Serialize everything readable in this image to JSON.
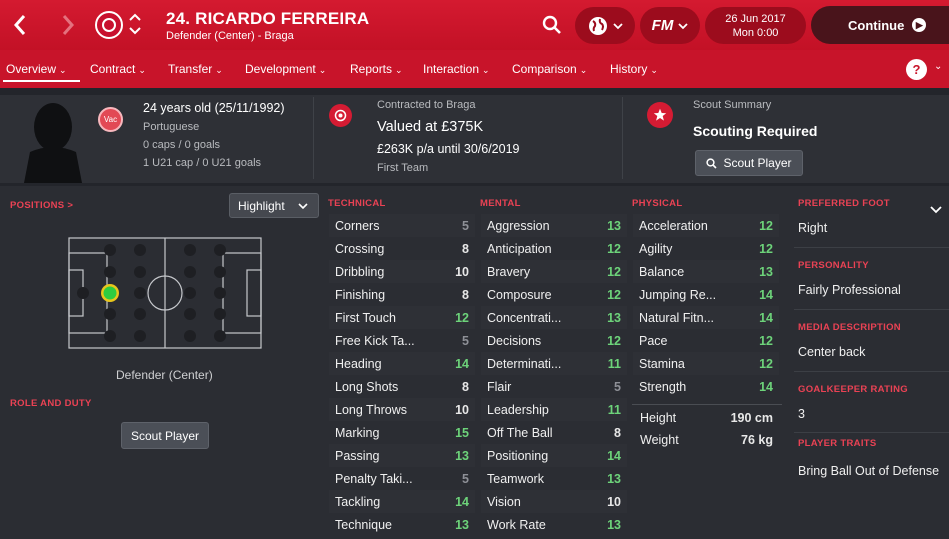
{
  "header": {
    "player_name": "24. RICARDO FERREIRA",
    "player_subtitle": "Defender (Center) - Braga",
    "date": "26 Jun 2017",
    "time": "Mon 0:00",
    "fm_label": "FM",
    "continue_label": "Continue"
  },
  "nav": {
    "items": [
      {
        "label": "Overview"
      },
      {
        "label": "Contract"
      },
      {
        "label": "Transfer"
      },
      {
        "label": "Development"
      },
      {
        "label": "Reports"
      },
      {
        "label": "Interaction"
      },
      {
        "label": "Comparison"
      },
      {
        "label": "History"
      }
    ],
    "help": "?"
  },
  "info": {
    "vac_badge": "Vac",
    "age": "24 years old (25/11/1992)",
    "nationality": "Portuguese",
    "caps": "0 caps / 0 goals",
    "u21_caps": "1 U21 cap / 0 U21 goals",
    "contract_label": "Contracted to Braga",
    "value": "Valued at £375K",
    "wage": "£263K p/a until 30/6/2019",
    "squad": "First Team",
    "scout_summary_label": "Scout Summary",
    "scout_status": "Scouting Required",
    "scout_button": "Scout Player"
  },
  "positions": {
    "heading": "POSITIONS >",
    "dropdown_value": "Highlight",
    "position_label": "Defender (Center)",
    "role_heading": "ROLE AND DUTY",
    "scout_button": "Scout Player"
  },
  "technical": {
    "heading": "TECHNICAL",
    "attributes": [
      {
        "name": "Corners",
        "value": 5
      },
      {
        "name": "Crossing",
        "value": 8
      },
      {
        "name": "Dribbling",
        "value": 10
      },
      {
        "name": "Finishing",
        "value": 8
      },
      {
        "name": "First Touch",
        "value": 12
      },
      {
        "name": "Free Kick Ta...",
        "value": 5
      },
      {
        "name": "Heading",
        "value": 14
      },
      {
        "name": "Long Shots",
        "value": 8
      },
      {
        "name": "Long Throws",
        "value": 10
      },
      {
        "name": "Marking",
        "value": 15
      },
      {
        "name": "Passing",
        "value": 13
      },
      {
        "name": "Penalty Taki...",
        "value": 5
      },
      {
        "name": "Tackling",
        "value": 14
      },
      {
        "name": "Technique",
        "value": 13
      }
    ]
  },
  "mental": {
    "heading": "MENTAL",
    "attributes": [
      {
        "name": "Aggression",
        "value": 13
      },
      {
        "name": "Anticipation",
        "value": 12
      },
      {
        "name": "Bravery",
        "value": 12
      },
      {
        "name": "Composure",
        "value": 12
      },
      {
        "name": "Concentrati...",
        "value": 13
      },
      {
        "name": "Decisions",
        "value": 12
      },
      {
        "name": "Determinati...",
        "value": 11
      },
      {
        "name": "Flair",
        "value": 5
      },
      {
        "name": "Leadership",
        "value": 11
      },
      {
        "name": "Off The Ball",
        "value": 8
      },
      {
        "name": "Positioning",
        "value": 14
      },
      {
        "name": "Teamwork",
        "value": 13
      },
      {
        "name": "Vision",
        "value": 10
      },
      {
        "name": "Work Rate",
        "value": 13
      }
    ]
  },
  "physical": {
    "heading": "PHYSICAL",
    "attributes": [
      {
        "name": "Acceleration",
        "value": 12
      },
      {
        "name": "Agility",
        "value": 12
      },
      {
        "name": "Balance",
        "value": 13
      },
      {
        "name": "Jumping Re...",
        "value": 14
      },
      {
        "name": "Natural Fitn...",
        "value": 14
      },
      {
        "name": "Pace",
        "value": 12
      },
      {
        "name": "Stamina",
        "value": 12
      },
      {
        "name": "Strength",
        "value": 14
      }
    ],
    "height_label": "Height",
    "height_value": "190 cm",
    "weight_label": "Weight",
    "weight_value": "76 kg"
  },
  "details": {
    "preferred_foot_heading": "PREFERRED FOOT",
    "preferred_foot": "Right",
    "personality_heading": "PERSONALITY",
    "personality": "Fairly Professional",
    "media_heading": "MEDIA DESCRIPTION",
    "media": "Center back",
    "gk_heading": "GOALKEEPER RATING",
    "gk_rating": "3",
    "traits_heading": "PLAYER TRAITS",
    "traits": "Bring Ball Out of Defense"
  },
  "colors": {
    "header_red": "#d41a30",
    "nav_red": "#c8142a",
    "accent_heading": "#ea4254",
    "good_value": "#6dd37a",
    "position_dot": "#2ecc40"
  }
}
